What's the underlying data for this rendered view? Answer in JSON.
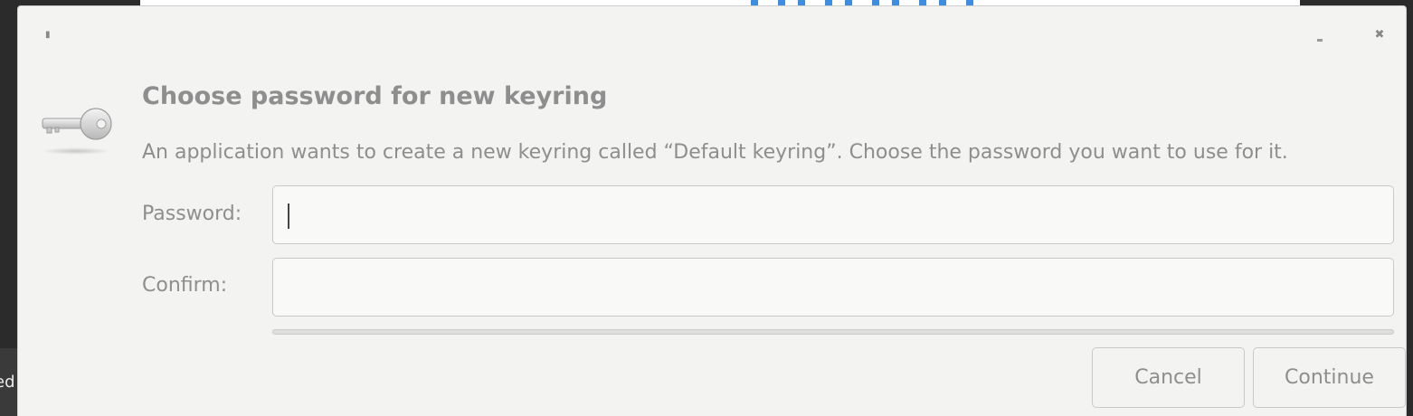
{
  "background": {
    "left_panel_text": "ed"
  },
  "dialog": {
    "title": "Choose password for new keyring",
    "message": "An application wants to create a new keyring called “Default keyring”. Choose the password you want to use for it.",
    "icon": "keyring-key-icon",
    "window_controls": {
      "menu_icon": "window-menu-icon",
      "minimize_icon": "minimize-icon",
      "close_icon": "close-icon",
      "close_glyph": "✖"
    },
    "password": {
      "label": "Password:",
      "value": ""
    },
    "confirm": {
      "label": "Confirm:",
      "value": ""
    },
    "strength": 0,
    "buttons": {
      "cancel": "Cancel",
      "continue": "Continue"
    }
  },
  "colors": {
    "dialog_bg": "#f3f3f2",
    "text": "#8e8e8e",
    "accent": "#3f8de0"
  }
}
